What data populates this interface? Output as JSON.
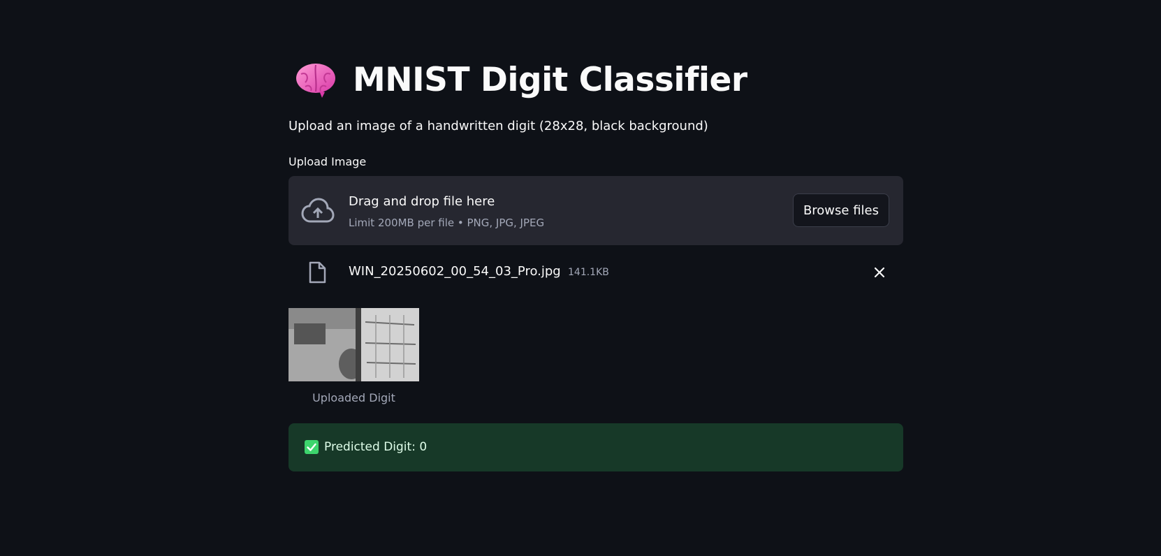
{
  "app": {
    "title": "MNIST Digit Classifier",
    "subtitle": "Upload an image of a handwritten digit (28x28, black background)"
  },
  "uploader": {
    "label": "Upload Image",
    "drop_title": "Drag and drop file here",
    "drop_hint": "Limit 200MB per file • PNG, JPG, JPEG",
    "browse_label": "Browse files"
  },
  "file": {
    "name": "WIN_20250602_00_54_03_Pro.jpg",
    "size": "141.1KB"
  },
  "image": {
    "caption": "Uploaded Digit"
  },
  "result": {
    "text": "Predicted Digit: 0"
  },
  "icons": {
    "title": "brain-icon",
    "upload": "cloud-upload-icon",
    "file": "file-icon",
    "remove": "close-icon",
    "success": "check-icon"
  },
  "colors": {
    "background": "#0e1117",
    "dropzone": "#262730",
    "success_bg": "#173928",
    "success_check": "#3dd56d",
    "text": "#fafafa",
    "muted_text": "#a3a8b8"
  }
}
